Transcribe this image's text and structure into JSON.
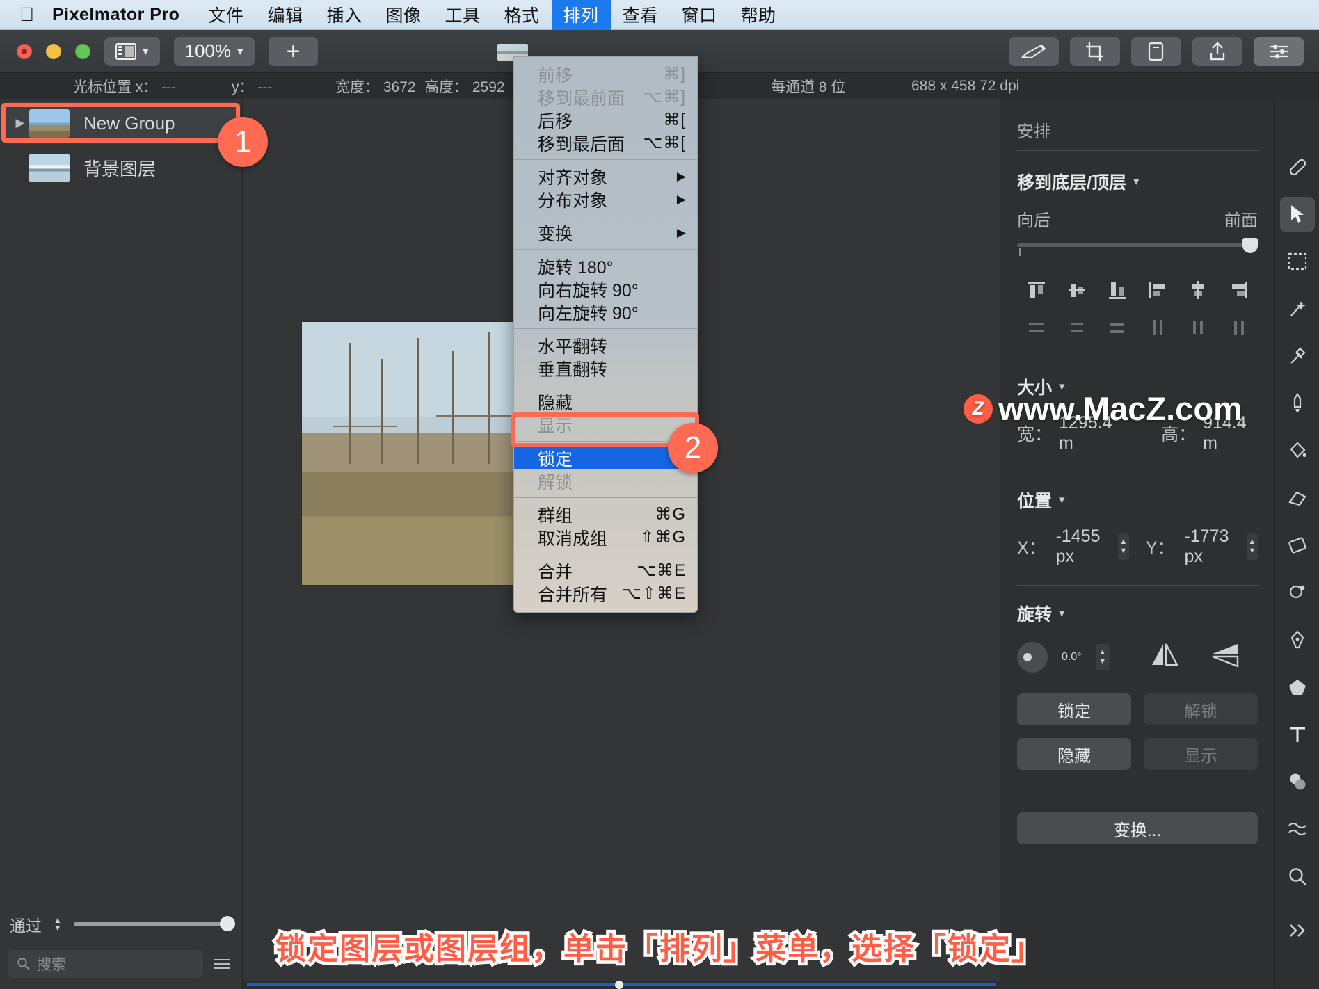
{
  "menubar": {
    "apple_icon": "apple-logo-icon",
    "items": [
      {
        "label": "Pixelmator Pro",
        "active": false,
        "brand": true
      },
      {
        "label": "文件",
        "active": false
      },
      {
        "label": "编辑",
        "active": false
      },
      {
        "label": "插入",
        "active": false
      },
      {
        "label": "图像",
        "active": false
      },
      {
        "label": "工具",
        "active": false
      },
      {
        "label": "格式",
        "active": false
      },
      {
        "label": "排列",
        "active": true
      },
      {
        "label": "查看",
        "active": false
      },
      {
        "label": "窗口",
        "active": false
      },
      {
        "label": "帮助",
        "active": false
      }
    ]
  },
  "toolbar": {
    "panes_label": "",
    "zoom_label": "100%",
    "add_label": "+"
  },
  "infobar": {
    "cursor_label": "光标位置 x：",
    "cursor_x": "---",
    "cursor_y_label": "y：",
    "cursor_y": "---",
    "width_label": "宽度：",
    "width_value": "3672",
    "height_label": "高度：",
    "height_value": "2592",
    "depth": "每通道 8 位",
    "resolution": "688 x 458 72 dpi"
  },
  "layers": {
    "items": [
      {
        "name": "New Group",
        "selected": true,
        "has_disclosure": true
      },
      {
        "name": "背景图层",
        "selected": false,
        "has_disclosure": false
      }
    ],
    "blend_label": "通过",
    "search_placeholder": "搜索"
  },
  "menu": {
    "groups": [
      {
        "items": [
          {
            "label": "前移",
            "key": "⌘]",
            "disabled": true
          },
          {
            "label": "移到最前面",
            "key": "⌥⌘]",
            "disabled": true
          },
          {
            "label": "后移",
            "key": "⌘[",
            "disabled": false
          },
          {
            "label": "移到最后面",
            "key": "⌥⌘[",
            "disabled": false
          }
        ]
      },
      {
        "items": [
          {
            "label": "对齐对象",
            "key": "▶",
            "disabled": false,
            "submenu": true
          },
          {
            "label": "分布对象",
            "key": "▶",
            "disabled": false,
            "submenu": true
          }
        ]
      },
      {
        "items": [
          {
            "label": "变换",
            "key": "▶",
            "disabled": false,
            "submenu": true
          }
        ]
      },
      {
        "items": [
          {
            "label": "旋转 180°",
            "key": "",
            "disabled": false
          },
          {
            "label": "向右旋转 90°",
            "key": "",
            "disabled": false
          },
          {
            "label": "向左旋转 90°",
            "key": "",
            "disabled": false
          }
        ]
      },
      {
        "items": [
          {
            "label": "水平翻转",
            "key": "",
            "disabled": false
          },
          {
            "label": "垂直翻转",
            "key": "",
            "disabled": false
          }
        ]
      },
      {
        "items": [
          {
            "label": "隐藏",
            "key": "",
            "disabled": false
          },
          {
            "label": "显示",
            "key": "",
            "disabled": true
          }
        ]
      },
      {
        "items": [
          {
            "label": "锁定",
            "key": "",
            "disabled": false,
            "highlighted": true
          },
          {
            "label": "解锁",
            "key": "",
            "disabled": true
          }
        ]
      },
      {
        "items": [
          {
            "label": "群组",
            "key": "⌘G",
            "disabled": false
          },
          {
            "label": "取消成组",
            "key": "⇧⌘G",
            "disabled": false
          }
        ]
      },
      {
        "items": [
          {
            "label": "合并",
            "key": "⌥⌘E",
            "disabled": false
          },
          {
            "label": "合并所有",
            "key": "⌥⇧⌘E",
            "disabled": false
          }
        ]
      }
    ]
  },
  "inspector": {
    "section_title": "安排",
    "arrange": {
      "title": "移到底层/顶层",
      "back_label": "向后",
      "front_label": "前面"
    },
    "size": {
      "title": "大小",
      "width_label": "宽：",
      "width_value": "1295.4 m",
      "height_label": "高：",
      "height_value": "914.4 m"
    },
    "position": {
      "title": "位置",
      "x_label": "X：",
      "x_value": "-1455 px",
      "y_label": "Y：",
      "y_value": "-1773 px"
    },
    "rotation": {
      "title": "旋转",
      "angle_value": "0.0°"
    },
    "buttons": {
      "lock": "锁定",
      "unlock": "解锁",
      "hide": "隐藏",
      "show": "显示",
      "transform": "变换..."
    }
  },
  "annotations": {
    "badge1": "1",
    "badge2": "2",
    "caption": "锁定图层或图层组，单击「排列」菜单，选择「锁定」",
    "watermark": "www.MacZ.com",
    "watermark_mark": "Z"
  },
  "colors": {
    "accent_red": "#ff6a52",
    "menu_highlight": "#1566e0",
    "menubar_active": "#1b7aee"
  }
}
